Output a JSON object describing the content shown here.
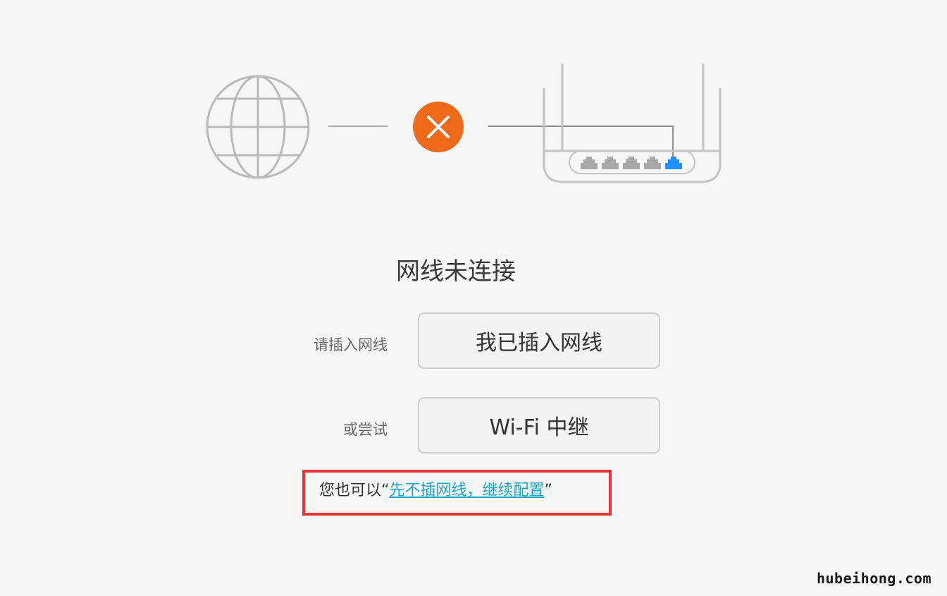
{
  "status": {
    "title": "网线未连接"
  },
  "options": {
    "plug_label": "请插入网线",
    "plug_button": "我已插入网线",
    "try_label": "或尝试",
    "wifi_button": "Wi-Fi 中继"
  },
  "note": {
    "prefix": "您也可以",
    "quote_open": "“",
    "link_text": "先不插网线，继续配置",
    "quote_close": "”"
  },
  "watermark": "hubeihong.com",
  "colors": {
    "error_accent": "#ee6a1a",
    "active_port": "#1e90ff",
    "highlight_border": "#e8353b",
    "link": "#1aa5c4"
  },
  "icons": [
    "globe-icon",
    "error-x-icon",
    "router-icon"
  ]
}
